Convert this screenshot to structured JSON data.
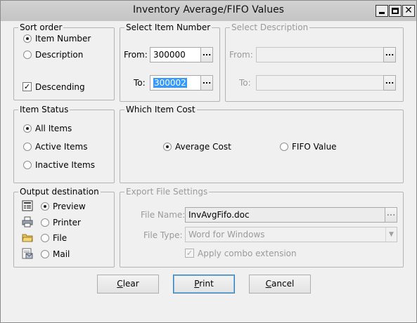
{
  "window": {
    "title": "Inventory Average/FIFO Values",
    "controls": {
      "minimize": "minimize",
      "maximize": "maximize",
      "close": "close"
    }
  },
  "sort_order": {
    "legend": "Sort order",
    "options": [
      {
        "label": "Item Number",
        "selected": true
      },
      {
        "label": "Description",
        "selected": false
      }
    ],
    "descending": {
      "label": "Descending",
      "checked": true
    }
  },
  "select_item_number": {
    "legend": "Select Item Number",
    "from_label": "From:",
    "from_value": "300000",
    "to_label": "To:",
    "to_value": "300002",
    "browse_label": "..."
  },
  "select_description": {
    "legend": "Select Description",
    "from_label": "From:",
    "from_value": "",
    "to_label": "To:",
    "to_value": "",
    "browse_label": "..."
  },
  "item_status": {
    "legend": "Item Status",
    "options": [
      {
        "label": "All Items",
        "selected": true
      },
      {
        "label": "Active Items",
        "selected": false
      },
      {
        "label": "Inactive Items",
        "selected": false
      }
    ]
  },
  "which_item_cost": {
    "legend": "Which Item Cost",
    "options": [
      {
        "label": "Average Cost",
        "selected": true
      },
      {
        "label": "FIFO Value",
        "selected": false
      }
    ]
  },
  "output_destination": {
    "legend": "Output destination",
    "options": [
      {
        "label": "Preview",
        "selected": true,
        "icon": "preview-icon"
      },
      {
        "label": "Printer",
        "selected": false,
        "icon": "printer-icon"
      },
      {
        "label": "File",
        "selected": false,
        "icon": "folder-icon"
      },
      {
        "label": "Mail",
        "selected": false,
        "icon": "mail-icon"
      }
    ]
  },
  "export_settings": {
    "legend": "Export File Settings",
    "file_name_label": "File Name:",
    "file_name_value": "InvAvgFifo.doc",
    "file_type_label": "File Type:",
    "file_type_value": "Word for Windows",
    "apply_extension": {
      "label": "Apply combo extension",
      "checked": true
    },
    "browse_label": "..."
  },
  "buttons": {
    "clear": {
      "mnemonic": "C",
      "rest": "lear"
    },
    "print": {
      "mnemonic": "P",
      "rest": "rint"
    },
    "cancel": {
      "mnemonic": "C",
      "rest": "ancel"
    }
  },
  "colors": {
    "selection": "#3399ff",
    "disabled_text": "#9a9a9a",
    "window_bg": "#f0f0f0"
  }
}
